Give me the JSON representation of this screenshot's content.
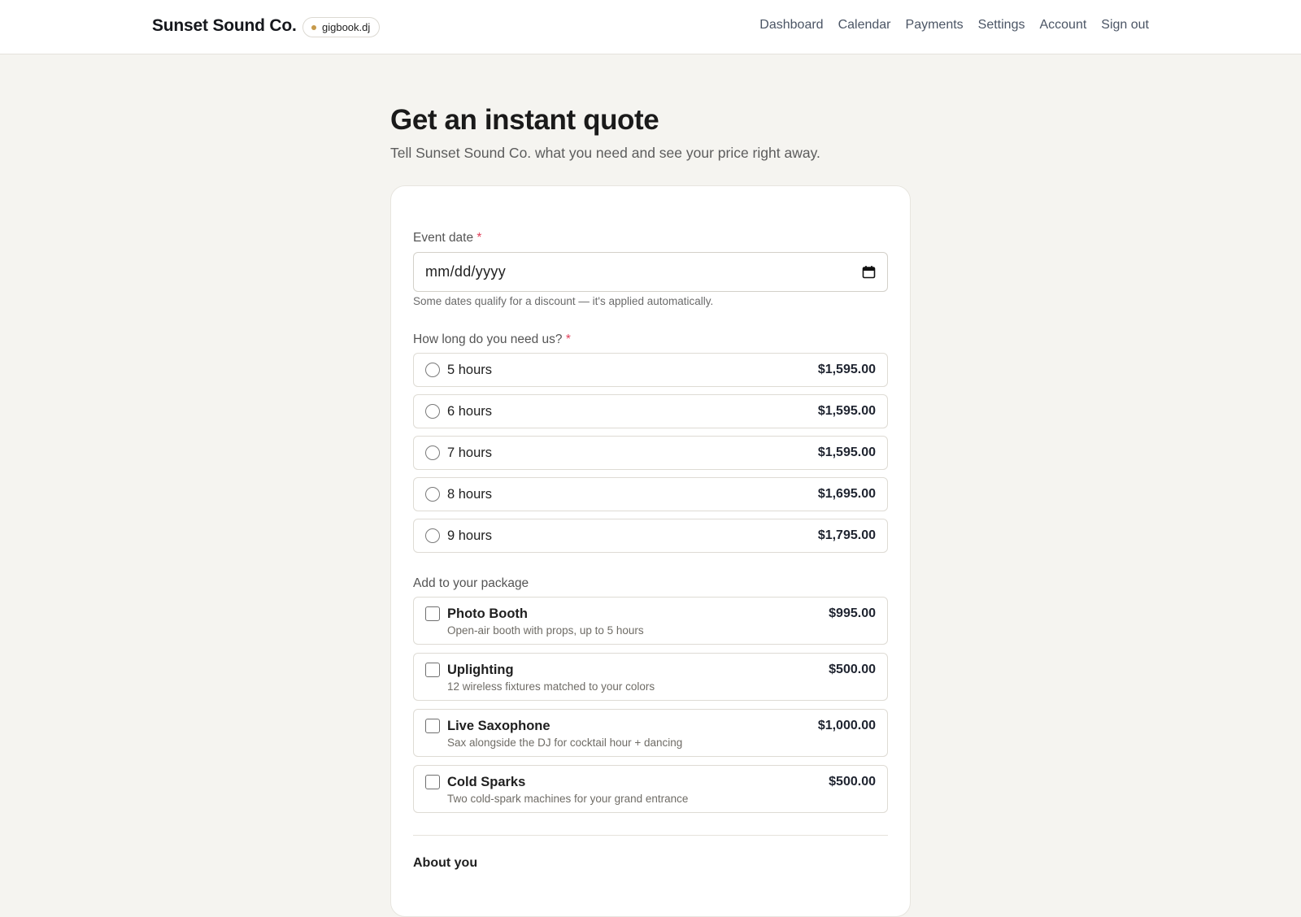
{
  "header": {
    "brand": "Sunset Sound Co.",
    "badge": "gigbook.dj",
    "nav": [
      "Dashboard",
      "Calendar",
      "Payments",
      "Settings",
      "Account",
      "Sign out"
    ]
  },
  "page": {
    "title": "Get an instant quote",
    "subtitle": "Tell Sunset Sound Co. what you need and see your price right away."
  },
  "form": {
    "event_date": {
      "label": "Event date",
      "required_mark": "*",
      "placeholder": "mm/dd/yyyy",
      "help": "Some dates qualify for a discount — it's applied automatically."
    },
    "duration": {
      "label": "How long do you need us?",
      "required_mark": "*",
      "options": [
        {
          "label": "5 hours",
          "price": "$1,595.00"
        },
        {
          "label": "6 hours",
          "price": "$1,595.00"
        },
        {
          "label": "7 hours",
          "price": "$1,595.00"
        },
        {
          "label": "8 hours",
          "price": "$1,695.00"
        },
        {
          "label": "9 hours",
          "price": "$1,795.00"
        }
      ]
    },
    "addons": {
      "label": "Add to your package",
      "items": [
        {
          "name": "Photo Booth",
          "desc": "Open-air booth with props, up to 5 hours",
          "price": "$995.00"
        },
        {
          "name": "Uplighting",
          "desc": "12 wireless fixtures matched to your colors",
          "price": "$500.00"
        },
        {
          "name": "Live Saxophone",
          "desc": "Sax alongside the DJ for cocktail hour + dancing",
          "price": "$1,000.00"
        },
        {
          "name": "Cold Sparks",
          "desc": "Two cold-spark machines for your grand entrance",
          "price": "$500.00"
        }
      ]
    },
    "about_heading": "About you"
  },
  "colors": {
    "background": "#f5f4f0",
    "required": "#e1415b",
    "badge_dot": "#c69a4a"
  },
  "icons": {
    "date_picker": "calendar-icon",
    "badge": "status-dot"
  }
}
